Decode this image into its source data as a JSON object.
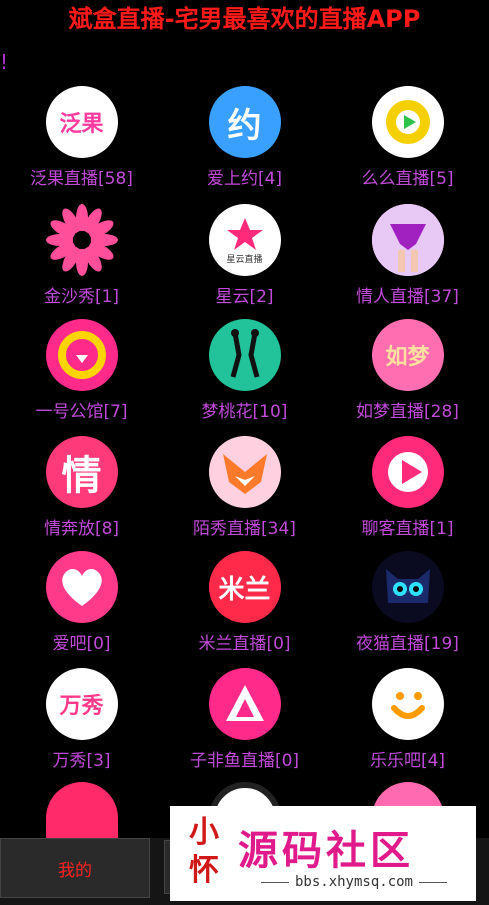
{
  "header": {
    "title": "斌盒直播-宅男最喜欢的直播APP",
    "bang": "!"
  },
  "apps": [
    {
      "label": "泛果直播[58]",
      "icon": "fanguo-logo-icon",
      "icon_text": "泛果"
    },
    {
      "label": "爱上约[4]",
      "icon": "yue-logo-icon",
      "icon_text": "约"
    },
    {
      "label": "么么直播[5]",
      "icon": "play-icon",
      "icon_text": ""
    },
    {
      "label": "金沙秀[1]",
      "icon": "pinwheel-icon",
      "icon_text": ""
    },
    {
      "label": "星云[2]",
      "icon": "star-logo-icon",
      "icon_text": "星云直播"
    },
    {
      "label": "情人直播[37]",
      "icon": "lingerie-icon",
      "icon_text": ""
    },
    {
      "label": "一号公馆[7]",
      "icon": "ring-logo-icon",
      "icon_text": ""
    },
    {
      "label": "梦桃花[10]",
      "icon": "dancers-icon",
      "icon_text": ""
    },
    {
      "label": "如梦直播[28]",
      "icon": "rumeng-logo-icon",
      "icon_text": "如梦"
    },
    {
      "label": "情奔放[8]",
      "icon": "qing-logo-icon",
      "icon_text": "情"
    },
    {
      "label": "陌秀直播[34]",
      "icon": "fox-logo-icon",
      "icon_text": ""
    },
    {
      "label": "聊客直播[1]",
      "icon": "play-circle-icon",
      "icon_text": ""
    },
    {
      "label": "爱吧[0]",
      "icon": "heart-icon",
      "icon_text": ""
    },
    {
      "label": "米兰直播[0]",
      "icon": "milan-logo-icon",
      "icon_text": "米兰"
    },
    {
      "label": "夜猫直播[19]",
      "icon": "cat-icon",
      "icon_text": ""
    },
    {
      "label": "万秀[3]",
      "icon": "wanxiu-logo-icon",
      "icon_text": "万秀"
    },
    {
      "label": "子非鱼直播[0]",
      "icon": "fish-logo-icon",
      "icon_text": ""
    },
    {
      "label": "乐乐吧[4]",
      "icon": "smile-icon",
      "icon_text": ""
    }
  ],
  "bottom": {
    "my_tab": "我的"
  },
  "watermark": {
    "seal": "小怀",
    "brand": "源码社区",
    "url": "bbs.xhymsq.com"
  },
  "colors": {
    "title": "#ff1a1a",
    "label": "#c24ad9"
  }
}
